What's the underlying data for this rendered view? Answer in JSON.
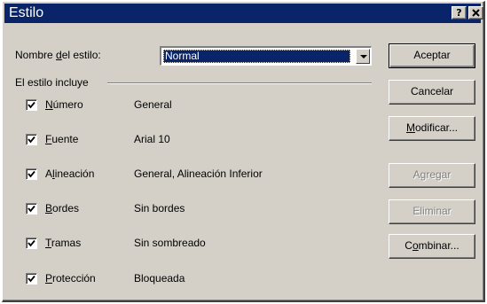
{
  "window": {
    "title": "Estilo",
    "help_btn": "?",
    "close_btn": "x"
  },
  "style_name": {
    "label_pre": "Nombre ",
    "label_u": "d",
    "label_post": "el estilo:",
    "value": "Normal"
  },
  "group": {
    "label": "El estilo incluye"
  },
  "rows": [
    {
      "u": "N",
      "rest": "úmero",
      "pre": "",
      "value": "General",
      "checked": true
    },
    {
      "u": "F",
      "rest": "uente",
      "pre": "",
      "value": "Arial 10",
      "checked": true
    },
    {
      "pre": "A",
      "u": "l",
      "rest": "ineación",
      "value": "General, Alineación Inferior",
      "checked": true
    },
    {
      "u": "B",
      "rest": "ordes",
      "pre": "",
      "value": "Sin bordes",
      "checked": true
    },
    {
      "u": "T",
      "rest": "ramas",
      "pre": "",
      "value": "Sin sombreado",
      "checked": true
    },
    {
      "u": "P",
      "rest": "rotección",
      "pre": "",
      "value": "Bloqueada",
      "checked": true
    }
  ],
  "buttons": {
    "accept": "Aceptar",
    "cancel": "Cancelar",
    "modify_u": "M",
    "modify_rest": "odificar...",
    "add": "Agregar",
    "delete": "Eliminar",
    "merge_pre": "C",
    "merge_u": "o",
    "merge_rest": "mbinar..."
  }
}
